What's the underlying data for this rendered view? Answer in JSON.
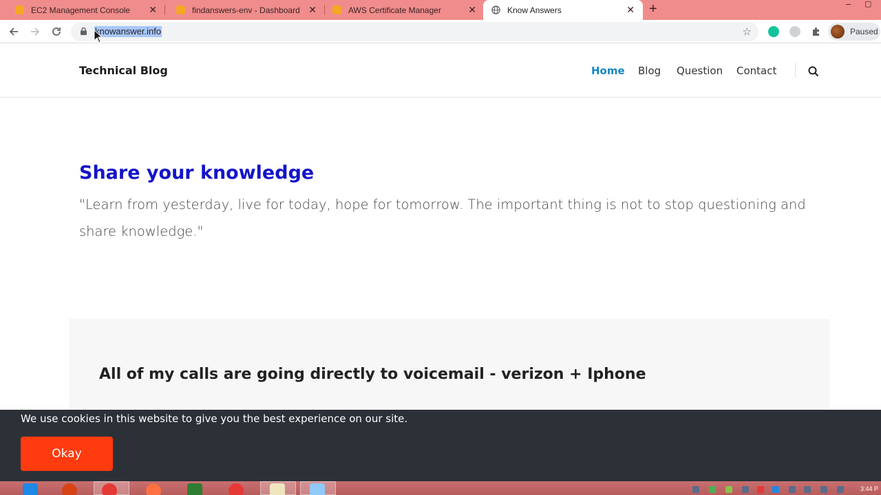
{
  "browser": {
    "tabs": [
      {
        "title": "EC2 Management Console",
        "active": false
      },
      {
        "title": "findanswers-env - Dashboard",
        "active": false
      },
      {
        "title": "AWS Certificate Manager",
        "active": false
      },
      {
        "title": "Know Answers",
        "active": true
      }
    ],
    "url": "knowanswer.info",
    "profile_label": "Paused"
  },
  "site": {
    "brand": "Technical Blog",
    "nav": [
      "Home",
      "Blog",
      "Question",
      "Contact"
    ],
    "active_nav": "Home"
  },
  "hero": {
    "title": "Share your knowledge",
    "quote": "\"Learn from yesterday, live for today, hope for tomorrow. The important thing is not to stop questioning and share knowledge.\""
  },
  "post": {
    "title": "All of my calls are going directly to voicemail - verizon + Iphone"
  },
  "cookie_bar": {
    "message": "We use cookies in this website to give you the best experience on our site.",
    "button": "Okay"
  },
  "taskbar": {
    "clock": "3:44 P"
  },
  "colors": {
    "tabstrip": "#f08c8c",
    "hero_title": "#1414c8",
    "nav_active": "#1687c4",
    "cookie_bg": "#2c3138",
    "okay_button": "#ff3b0f"
  }
}
